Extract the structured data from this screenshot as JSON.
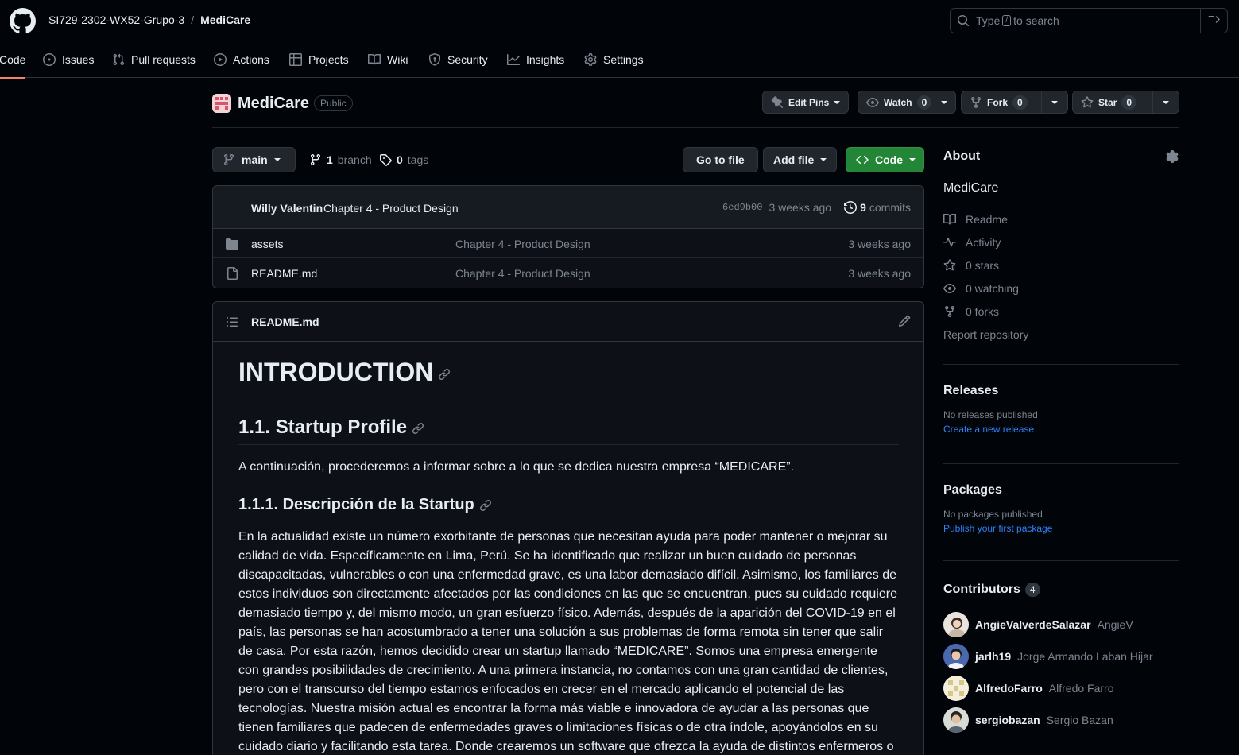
{
  "header": {
    "owner": "SI729-2302-WX52-Grupo-3",
    "separator": "/",
    "repo": "MediCare",
    "search_prefix": "Type",
    "search_key": "/",
    "search_suffix": "to search"
  },
  "nav": {
    "code": "Code",
    "issues": "Issues",
    "pulls": "Pull requests",
    "actions": "Actions",
    "projects": "Projects",
    "wiki": "Wiki",
    "security": "Security",
    "insights": "Insights",
    "settings": "Settings"
  },
  "repo": {
    "name": "MediCare",
    "visibility": "Public",
    "edit_pins": "Edit Pins",
    "watch": "Watch",
    "watch_count": "0",
    "fork": "Fork",
    "fork_count": "0",
    "star": "Star",
    "star_count": "0"
  },
  "filenav": {
    "branch": "main",
    "branch_count": "1",
    "branch_label": "branch",
    "tag_count": "0",
    "tag_label": "tags",
    "go_to_file": "Go to file",
    "add_file": "Add file",
    "code": "Code"
  },
  "commit": {
    "author": "Willy Valentin",
    "message": "Chapter 4 - Product Design",
    "sha": "6ed9b00",
    "age": "3 weeks ago",
    "count": "9",
    "count_label": "commits"
  },
  "files": [
    {
      "name": "assets",
      "type": "folder",
      "message": "Chapter 4 - Product Design",
      "age": "3 weeks ago"
    },
    {
      "name": "README.md",
      "type": "file",
      "message": "Chapter 4 - Product Design",
      "age": "3 weeks ago"
    }
  ],
  "readme": {
    "filename": "README.md",
    "h1": "INTRODUCTION",
    "h2": "1.1. Startup Profile",
    "p1": "A continuación, procederemos a informar sobre a lo que se dedica nuestra empresa “MEDICARE”.",
    "h3": "1.1.1. Descripción de la Startup",
    "p2": "En la actualidad existe un número exorbitante de personas que necesitan ayuda para poder mantener o mejorar su calidad de vida. Específicamente en Lima, Perú. Se ha identificado que realizar un buen cuidado de personas discapacitadas, vulnerables o con una enfermedad grave, es una labor demasiado difícil. Asimismo, los familiares de estos individuos son directamente afectados por las condiciones en las que se encuentran, pues su cuidado requiere demasiado tiempo y, del mismo modo, un gran esfuerzo físico. Además, después de la aparición del COVID-19 en el país, las personas se han acostumbrado a tener una solución a sus problemas de forma remota sin tener que salir de casa. Por esta razón, hemos decidido crear un startup llamado “MEDICARE”. Somos una empresa emergente con grandes posibilidades de crecimiento. A una primera instancia, no contamos con una gran cantidad de clientes, pero con el transcurso del tiempo estamos enfocados en crecer en el mercado aplicando el potencial de las tecnologías. Nuestra misión actual es encontrar la forma más viable e innovadora de ayudar a las personas que tienen familiares que padecen de enfermedades graves o limitaciones físicas o de otra índole, apoyándolos en su cuidado diario y facilitando esta tarea. Donde crearemos un software que ofrezca la ayuda de distintos enfermeros o doctores"
  },
  "about": {
    "title": "About",
    "description": "MediCare",
    "readme": "Readme",
    "activity": "Activity",
    "stars": "0 stars",
    "watching": "0 watching",
    "forks": "0 forks",
    "report": "Report repository"
  },
  "releases": {
    "title": "Releases",
    "empty": "No releases published",
    "link": "Create a new release"
  },
  "packages": {
    "title": "Packages",
    "empty": "No packages published",
    "link": "Publish your first package"
  },
  "contributors": {
    "title": "Contributors",
    "count": "4",
    "list": [
      {
        "login": "AngieValverdeSalazar",
        "name": "AngieV"
      },
      {
        "login": "jarlh19",
        "name": "Jorge Armando Laban Hijar"
      },
      {
        "login": "AlfredoFarro",
        "name": "Alfredo Farro"
      },
      {
        "login": "sergiobazan",
        "name": "Sergio Bazan"
      }
    ]
  },
  "colors": {
    "accent": "#f78166",
    "green": "#238636",
    "link": "#2f81f7",
    "bg": "#010409",
    "panel": "#0d1117"
  }
}
